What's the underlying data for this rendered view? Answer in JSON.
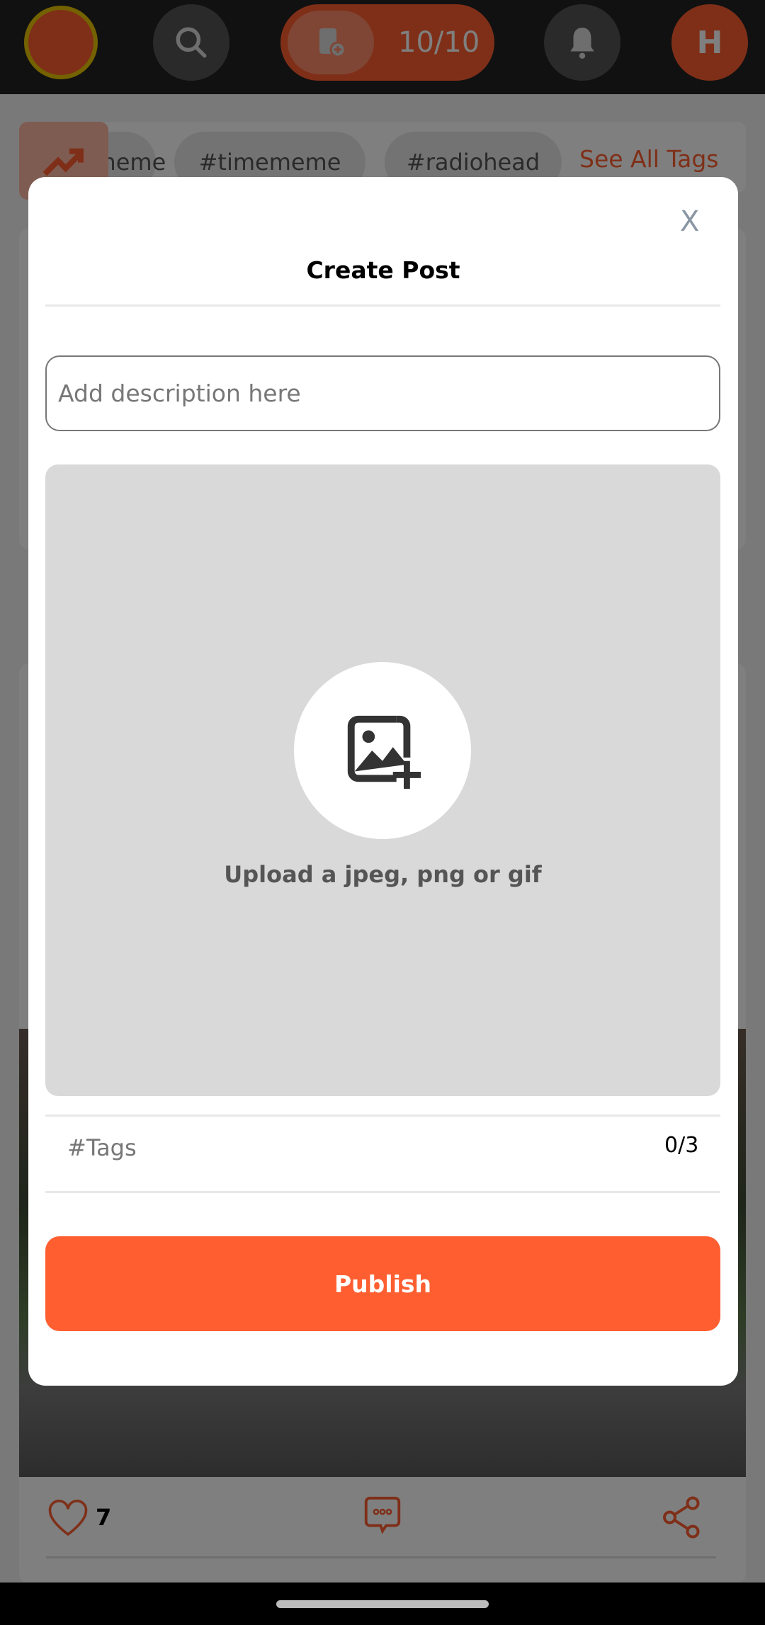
{
  "header": {
    "post_count": "10/10",
    "avatar_initial": "H"
  },
  "tagbar": {
    "tags": [
      "#meme",
      "#timememe",
      "#radiohead"
    ],
    "see_all": "See All Tags"
  },
  "post": {
    "likes": "7"
  },
  "modal": {
    "close": "X",
    "title": "Create Post",
    "description_placeholder": "Add description here",
    "upload_text": "Upload a jpeg, png or gif",
    "tags_placeholder": "#Tags",
    "tags_count": "0/3",
    "publish": "Publish"
  },
  "colors": {
    "accent": "#FF5F30",
    "upload_bg": "#D9D9D9"
  }
}
